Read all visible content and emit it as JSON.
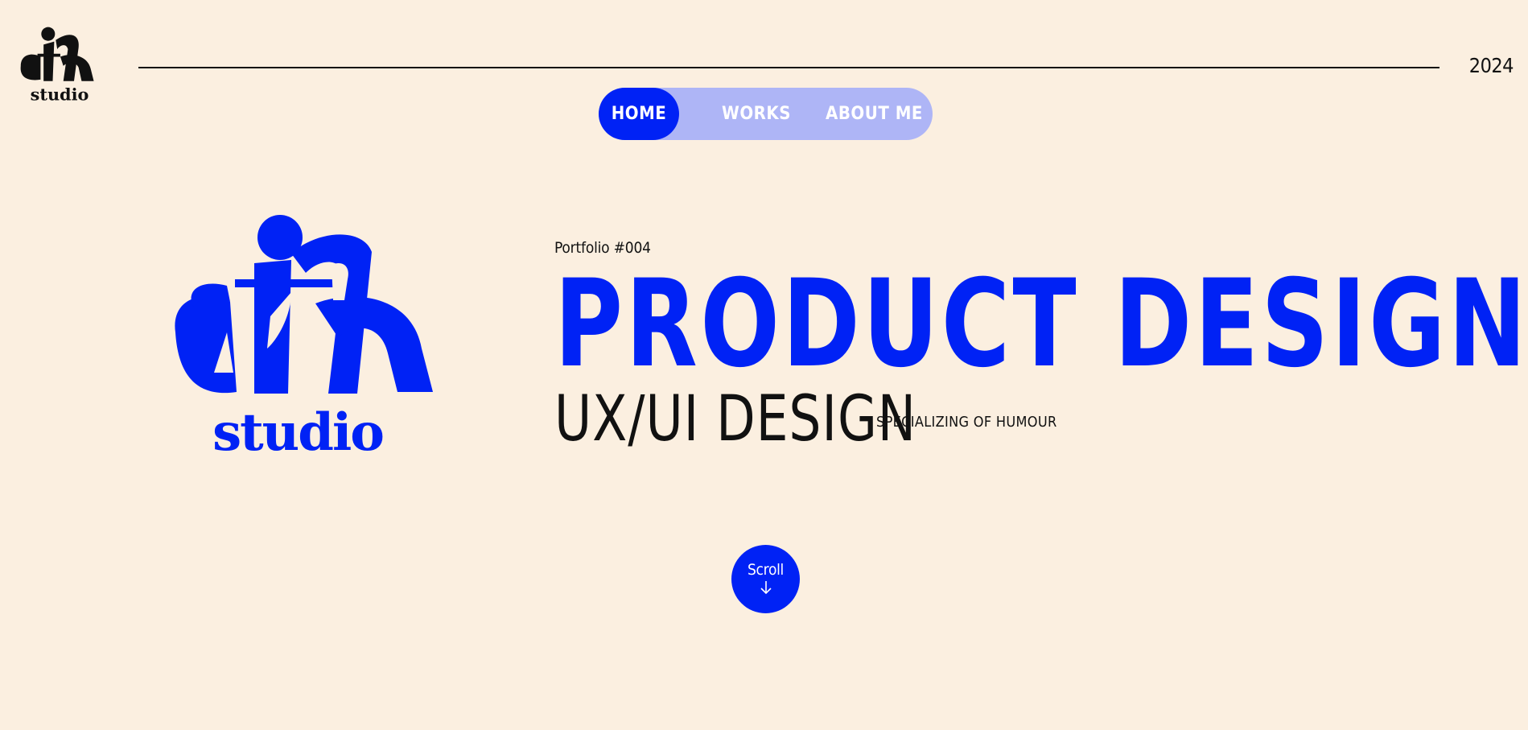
{
  "header": {
    "logo": {
      "icon": "aith-studio-logo",
      "letters": "aith",
      "word": "studio",
      "color": "#111111"
    },
    "year": "2024"
  },
  "nav": {
    "items": [
      {
        "label": "HOME",
        "active": true
      },
      {
        "label": "WORKS",
        "active": false
      },
      {
        "label": "ABOUT ME",
        "active": false
      }
    ]
  },
  "hero": {
    "logo": {
      "icon": "aith-studio-logo",
      "letters": "aith",
      "word": "studio",
      "color": "#0022F5"
    },
    "portfolio_tag": "Portfolio #004",
    "headline": "PRODUCT DESIGN",
    "subtitle": "UX/UI DESIGN",
    "subtitle_note": "SPECIALIZING OF HUMOUR"
  },
  "scroll": {
    "label": "Scroll",
    "icon": "arrow-down-icon"
  },
  "colors": {
    "background": "#FBEFE0",
    "accent": "#0022F5",
    "nav_track": "#AEB5F6",
    "text": "#111111"
  }
}
